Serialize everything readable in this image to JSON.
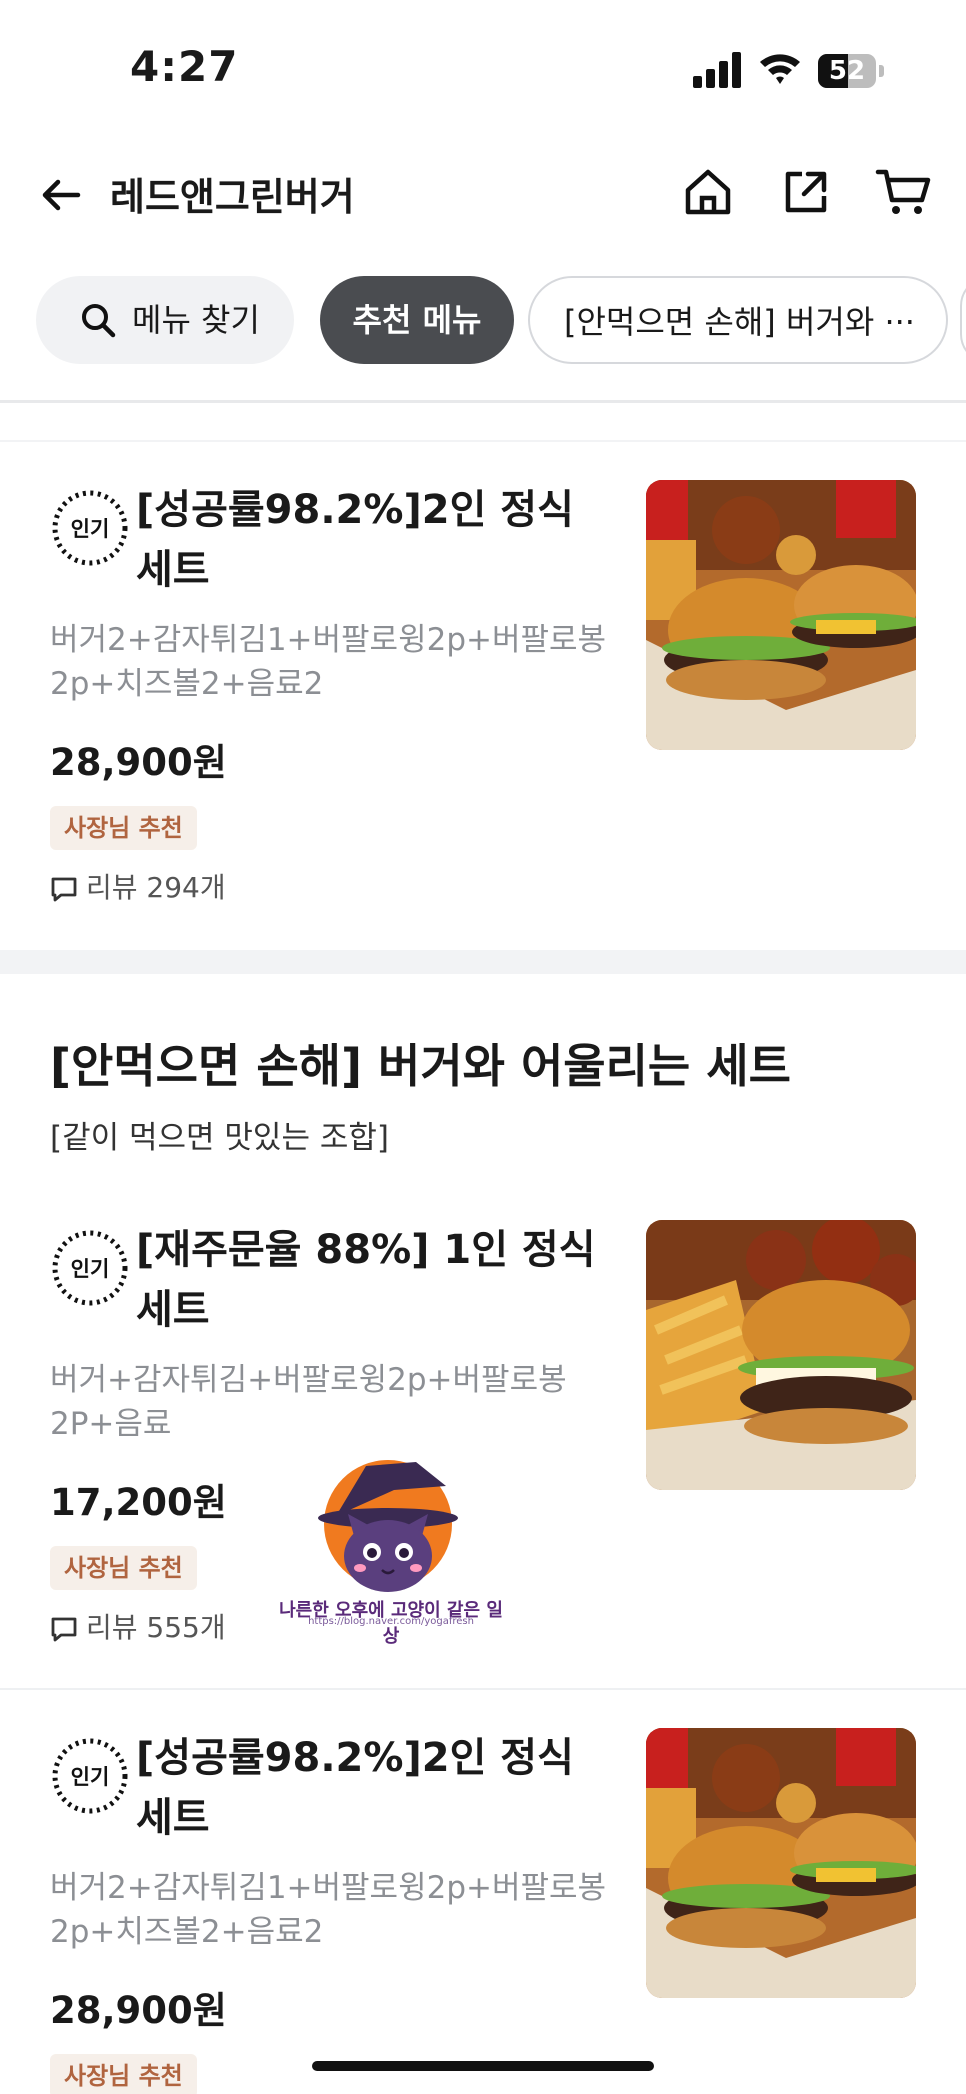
{
  "status_bar": {
    "time": "4:27",
    "battery": "52",
    "battery_level": 0.52
  },
  "header": {
    "title": "레드앤그린버거"
  },
  "tabs": {
    "search": "메뉴 찾기",
    "recommended": "추천 메뉴",
    "set": "[안먹으면 손해] 버거와 ···"
  },
  "items": [
    {
      "badge": "인기",
      "name_line1": "[성공률98.2%]2인 정식",
      "name_line2": "세트",
      "desc_line1": "버거2+감자튀김1+버팔로윙2p+버팔로봉",
      "desc_line2": "2p+치즈볼2+음료2",
      "price": "28,900원",
      "tag": "사장님 추천",
      "review": "리뷰 294개"
    },
    {
      "badge": "인기",
      "name_line1": "[재주문율 88%] 1인 정식",
      "name_line2": "세트",
      "desc_line1": "버거+감자튀김+버팔로윙2p+버팔로봉",
      "desc_line2": "2P+음료",
      "price": "17,200원",
      "tag": "사장님 추천",
      "review": "리뷰 555개"
    },
    {
      "badge": "인기",
      "name_line1": "[성공률98.2%]2인 정식",
      "name_line2": "세트",
      "desc_line1": "버거2+감자튀김1+버팔로윙2p+버팔로봉",
      "desc_line2": "2p+치즈볼2+음료2",
      "price": "28,900원",
      "tag": "사장님 추천"
    }
  ],
  "section": {
    "title": "[안먹으면 손해] 버거와 어울리는 세트",
    "subtitle": "[같이 먹으면 맛있는 조합]"
  },
  "watermark": {
    "text": "나른한 오후에 고양이 같은 일상",
    "url": "https://blog.naver.com/yogafresh"
  },
  "colors": {
    "accent_dark": "#4a4c50",
    "owner_tag_text": "#b0643f",
    "owner_tag_bg": "#f6efe9",
    "desc_gray": "#8c8f94"
  }
}
